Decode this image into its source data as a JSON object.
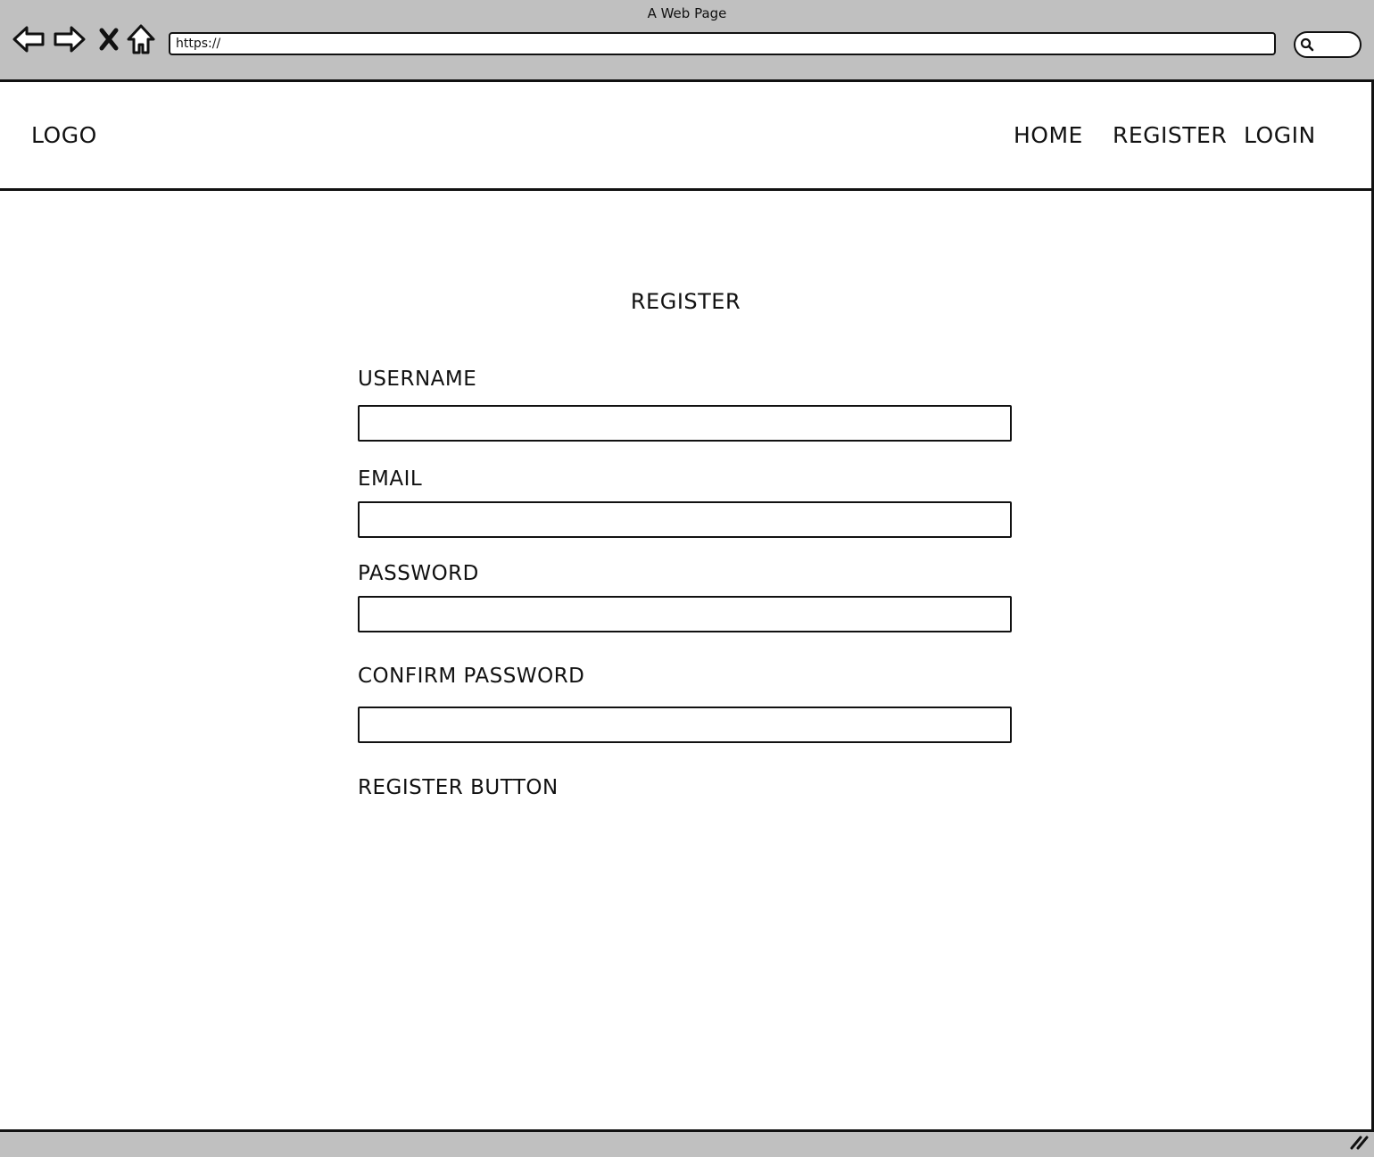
{
  "browser": {
    "window_title": "A Web Page",
    "url": "https://",
    "icons": {
      "back": "back-arrow-icon",
      "forward": "forward-arrow-icon",
      "stop": "close-icon",
      "home": "home-icon",
      "search": "search-icon",
      "resize": "resize-grip-icon"
    }
  },
  "header": {
    "logo": "LOGO",
    "nav": {
      "home": "HOME",
      "register": "REGISTER",
      "login": "LOGIN"
    }
  },
  "form": {
    "title": "REGISTER",
    "fields": [
      {
        "label": "USERNAME",
        "value": ""
      },
      {
        "label": "EMAIL",
        "value": ""
      },
      {
        "label": "PASSWORD",
        "value": ""
      },
      {
        "label": "CONFIRM PASSWORD",
        "value": ""
      }
    ],
    "submit_label": "REGISTER BUTTON"
  }
}
